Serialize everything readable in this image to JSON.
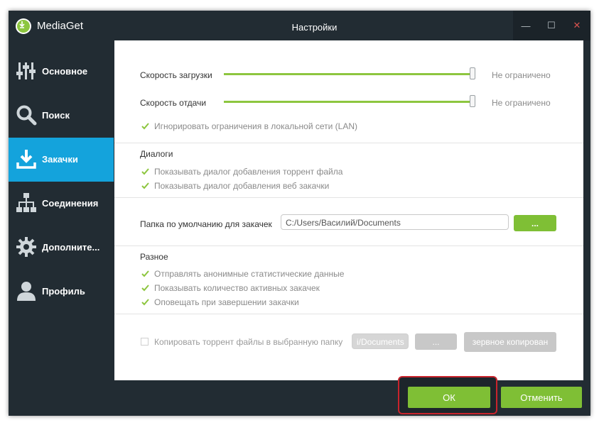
{
  "app": {
    "name": "MediaGet",
    "window_title": "Настройки"
  },
  "window_controls": {
    "minimize": "—",
    "maximize": "☐",
    "close": "✕"
  },
  "sidebar": {
    "items": [
      {
        "label": "Основное",
        "icon": "sliders-icon"
      },
      {
        "label": "Поиск",
        "icon": "search-icon"
      },
      {
        "label": "Закачки",
        "icon": "download-icon",
        "active": true
      },
      {
        "label": "Соединения",
        "icon": "network-icon"
      },
      {
        "label": "Дополните...",
        "icon": "gear-icon"
      },
      {
        "label": "Профиль",
        "icon": "user-icon"
      }
    ]
  },
  "speed": {
    "download_label": "Скорость загрузки",
    "download_value": "Не ограничено",
    "download_level": 1.0,
    "upload_label": "Скорость отдачи",
    "upload_value": "Не ограничено",
    "upload_level": 1.0,
    "ignore_lan_label": "Игнорировать ограничения в локальной сети (LAN)",
    "ignore_lan_checked": true
  },
  "dialogs": {
    "title": "Диалоги",
    "show_torrent_label": "Показывать диалог добавления торрент файла",
    "show_torrent_checked": true,
    "show_web_label": "Показывать диалог добавления веб закачки",
    "show_web_checked": true
  },
  "folder": {
    "label": "Папка по умолчанию для закачек",
    "value": "C:/Users/Василий/Documents",
    "browse_label": "..."
  },
  "misc": {
    "title": "Разное",
    "send_stats_label": "Отправлять анонимные статистические данные",
    "send_stats_checked": true,
    "show_active_label": "Показывать количество активных закачек",
    "show_active_checked": true,
    "notify_label": "Оповещать при завершении закачки",
    "notify_checked": true
  },
  "copy_torrent": {
    "label": "Копировать торрент файлы в выбранную папку",
    "checked": false,
    "folder_value": "i/Documents",
    "browse_label": "...",
    "backup_label": "зервное копирован"
  },
  "footer": {
    "ok_label": "ОК",
    "cancel_label": "Отменить"
  },
  "colors": {
    "accent_green": "#7fbf35",
    "sidebar_active": "#14a3dc",
    "window_bg": "#222c33",
    "highlight_red": "#c8232c"
  }
}
